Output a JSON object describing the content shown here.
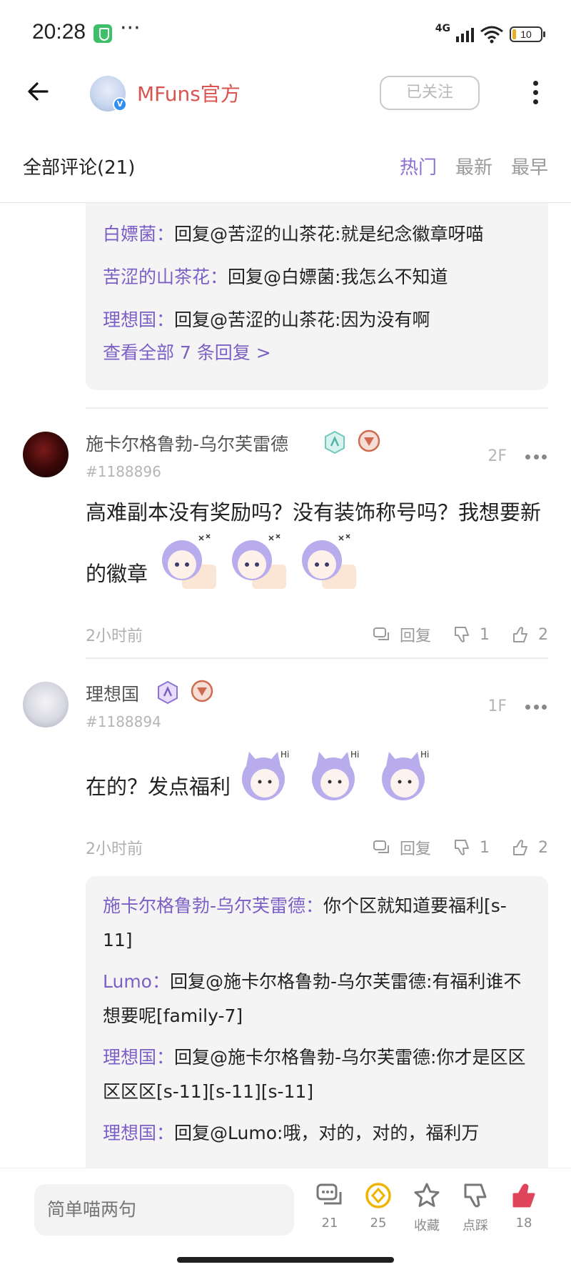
{
  "status_bar": {
    "time": "20:28",
    "network": "4G",
    "battery": "10"
  },
  "header": {
    "back_icon": "arrow-left-icon",
    "name": "MFuns官方",
    "follow_label": "已关注",
    "verified_glyph": "V",
    "accent_color": "#d9534f"
  },
  "comments_header": {
    "title": "全部评论(21)",
    "tabs": [
      {
        "label": "热门",
        "active": true
      },
      {
        "label": "最新",
        "active": false
      },
      {
        "label": "最早",
        "active": false
      }
    ],
    "active_color": "#8b6fcf"
  },
  "reply_box_top": {
    "replies": [
      {
        "author": "白嫖菌：",
        "text": "回复@苦涩的山茶花:就是纪念徽章呀喵"
      },
      {
        "author": "苦涩的山茶花：",
        "text": "回复@白嫖菌:我怎么不知道"
      },
      {
        "author": "理想国：",
        "text": "回复@苦涩的山茶花:因为没有啊"
      }
    ],
    "view_all": "查看全部 7 条回复 >"
  },
  "comments": [
    {
      "user": "施卡尔格鲁勃-乌尔芙雷德",
      "user_id": "#1188896",
      "floor": "2F",
      "text": "高难副本没有奖励吗？没有装饰称号吗？我想要新的徽章",
      "time": "2小时前",
      "reply_label": "回复",
      "dislike_count": "1",
      "like_count": "2"
    },
    {
      "user": "理想国",
      "user_id": "#1188894",
      "floor": "1F",
      "text": "在的？发点福利",
      "time": "2小时前",
      "reply_label": "回复",
      "dislike_count": "1",
      "like_count": "2"
    }
  ],
  "reply_box_bottom": {
    "replies": [
      {
        "author": "施卡尔格鲁勃-乌尔芙雷德：",
        "text": "你个区就知道要福利[s-11]"
      },
      {
        "author": "Lumo：",
        "text": "回复@施卡尔格鲁勃-乌尔芙雷德:有福利谁不想要呢[family-7]"
      },
      {
        "author": "理想国：",
        "text": "回复@施卡尔格鲁勃-乌尔芙雷德:你才是区区区区区[s-11][s-11][s-11]"
      },
      {
        "author": "理想国：",
        "text": "回复@Lumo:哦，对的，对的，福利万"
      }
    ]
  },
  "bottom_bar": {
    "input_placeholder": "简单喵两句",
    "comments_count": "21",
    "coins_count": "25",
    "favorite_label": "收藏",
    "dislike_label": "点踩",
    "likes_count": "18",
    "coin_color": "#f0b400",
    "like_color": "#e0445a"
  }
}
